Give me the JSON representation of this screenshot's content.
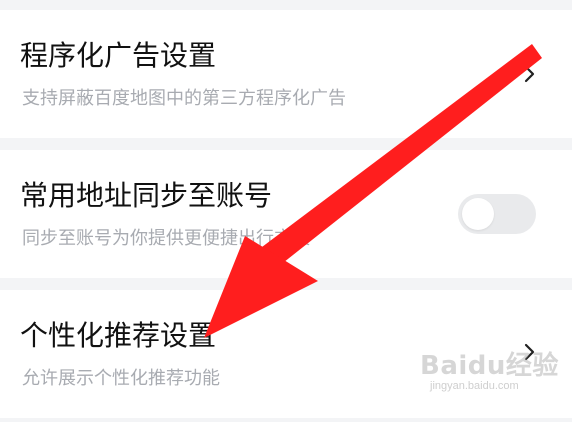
{
  "settings": {
    "items": [
      {
        "title": "程序化广告设置",
        "subtitle": "支持屏蔽百度地图中的第三方程序化广告",
        "control": "chevron-right-icon"
      },
      {
        "title": "常用地址同步至账号",
        "subtitle": "同步至账号为你提供更便捷出行方案",
        "control": "toggle",
        "toggle_on": false
      },
      {
        "title": "个性化推荐设置",
        "subtitle": "允许展示个性化推荐功能",
        "control": "chevron-right-icon"
      }
    ]
  },
  "overlay": {
    "arrow_color": "#ff1e1e",
    "icon": "pointer-arrow-icon"
  },
  "watermark": {
    "text": "Baidu经验",
    "url": "jingyan.baidu.com"
  },
  "colors": {
    "background": "#f3f4f6",
    "card": "#ffffff",
    "title_text": "#111111",
    "subtitle_text": "#a8abb1",
    "toggle_off": "#e9eaec"
  }
}
